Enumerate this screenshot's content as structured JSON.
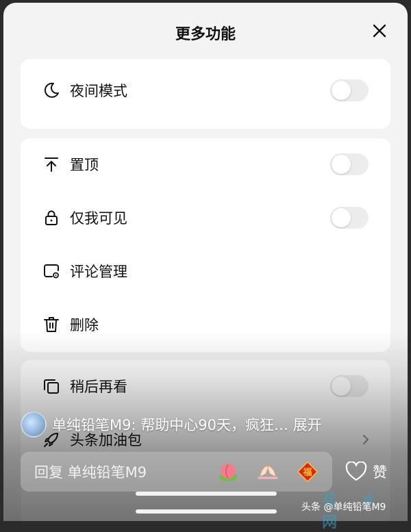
{
  "sheet": {
    "title": "更多功能"
  },
  "groups": [
    {
      "items": [
        {
          "label": "夜间模式",
          "icon": "moon-icon",
          "control": "toggle",
          "on": false
        }
      ]
    },
    {
      "items": [
        {
          "label": "置顶",
          "icon": "pin-top-icon",
          "control": "toggle",
          "on": false
        },
        {
          "label": "仅我可见",
          "icon": "lock-icon",
          "control": "toggle",
          "on": false
        },
        {
          "label": "评论管理",
          "icon": "comment-settings-icon",
          "control": "none"
        },
        {
          "label": "删除",
          "icon": "trash-icon",
          "control": "none"
        }
      ]
    },
    {
      "items": [
        {
          "label": "稍后再看",
          "icon": "copy-icon",
          "control": "toggle",
          "on": false
        },
        {
          "label": "头条加油包",
          "icon": "rocket-icon",
          "control": "chevron"
        }
      ]
    }
  ],
  "comment": {
    "text": "单纯铅笔M9: 帮助中心90天，疯狂… 展开"
  },
  "reply": {
    "placeholder": "回复 单纯铅笔M9",
    "emojis": [
      "peach-emoji",
      "hands-emoji",
      "fu-emoji"
    ]
  },
  "like": {
    "label": "赞"
  },
  "watermark": {
    "text": "头条 @单纯铅笔M9",
    "logo": "芸 水 网"
  }
}
